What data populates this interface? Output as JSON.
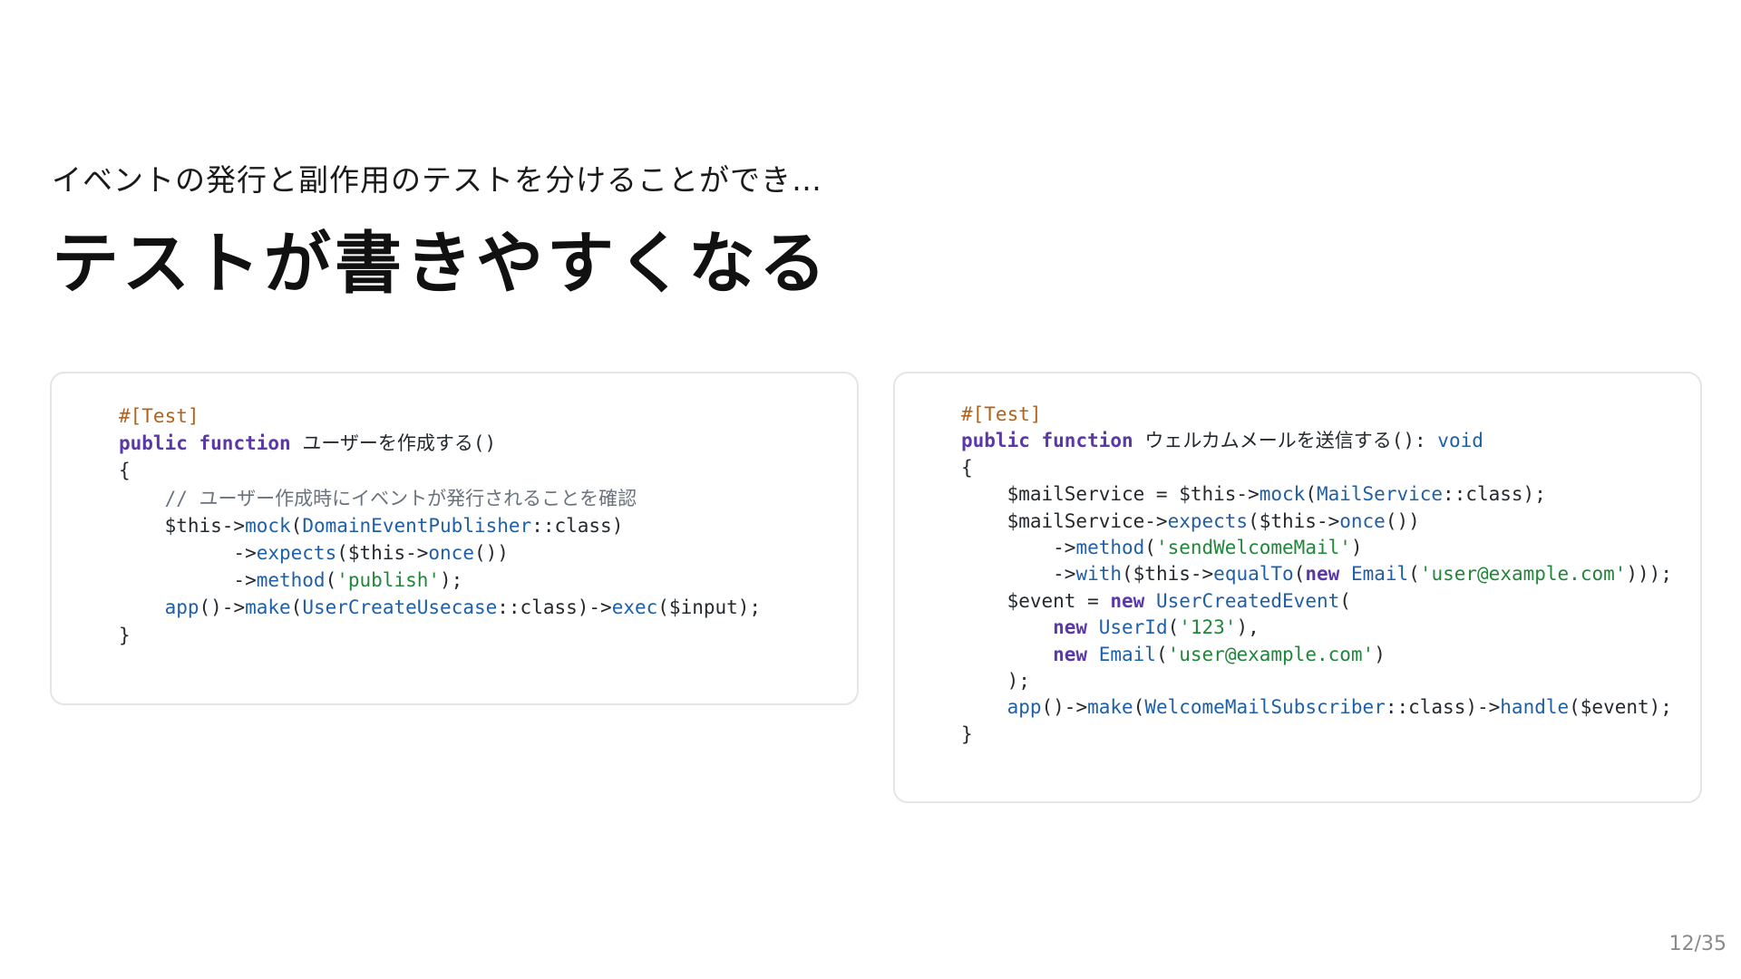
{
  "slide": {
    "subtitle": "イベントの発行と副作用のテストを分けることができ…",
    "title": "テストが書きやすくなる",
    "page_indicator": "12/35"
  },
  "left_code": {
    "l1": {
      "attr": "#[Test]"
    },
    "l2": {
      "kw1": "public",
      "kw2": "function",
      "name": "ユーザーを作成する()"
    },
    "l3": {
      "text": "{"
    },
    "l4": {
      "comment": "    // ユーザー作成時にイベントが発行されることを確認"
    },
    "l5": {
      "a": "    $this->",
      "fn": "mock",
      "b": "(",
      "cls": "DomainEventPublisher",
      "c": "::class)"
    },
    "l6": {
      "a": "          ->",
      "fn": "expects",
      "b": "($this->",
      "fn2": "once",
      "c": "())"
    },
    "l7": {
      "a": "          ->",
      "fn": "method",
      "b": "(",
      "str": "'publish'",
      "c": ");"
    },
    "l8": {
      "text": ""
    },
    "l9": {
      "fn": "    app",
      "a": "()->",
      "fn2": "make",
      "b": "(",
      "cls": "UserCreateUsecase",
      "c": "::class)->",
      "fn3": "exec",
      "d": "($input);"
    },
    "l10": {
      "text": "}"
    }
  },
  "right_code": {
    "l1": {
      "attr": "#[Test]"
    },
    "l2": {
      "kw1": "public",
      "kw2": "function",
      "name": "ウェルカムメールを送信する():",
      "type": "void"
    },
    "l3": {
      "text": "{"
    },
    "l4": {
      "a": "    $mailService = $this->",
      "fn": "mock",
      "b": "(",
      "cls": "MailService",
      "c": "::class);"
    },
    "l5": {
      "a": "    $mailService->",
      "fn": "expects",
      "b": "($this->",
      "fn2": "once",
      "c": "())"
    },
    "l6": {
      "a": "        ->",
      "fn": "method",
      "b": "(",
      "str": "'sendWelcomeMail'",
      "c": ")"
    },
    "l7": {
      "a": "        ->",
      "fn": "with",
      "b": "($this->",
      "fn2": "equalTo",
      "c": "(",
      "kw": "new",
      "cls": "Email",
      "d": "(",
      "str": "'user@example.com'",
      "e": ")));"
    },
    "l8": {
      "text": ""
    },
    "l9": {
      "a": "    $event = ",
      "kw": "new",
      "cls": "UserCreatedEvent",
      "b": "("
    },
    "l10": {
      "kw": "        new",
      "cls": "UserId",
      "a": "(",
      "str": "'123'",
      "b": "),"
    },
    "l11": {
      "kw": "        new",
      "cls": "Email",
      "a": "(",
      "str": "'user@example.com'",
      "b": ")"
    },
    "l12": {
      "text": "    );"
    },
    "l13": {
      "fn": "    app",
      "a": "()->",
      "fn2": "make",
      "b": "(",
      "cls": "WelcomeMailSubscriber",
      "c": "::class)->",
      "fn3": "handle",
      "d": "($event);"
    },
    "l14": {
      "text": "}"
    }
  }
}
